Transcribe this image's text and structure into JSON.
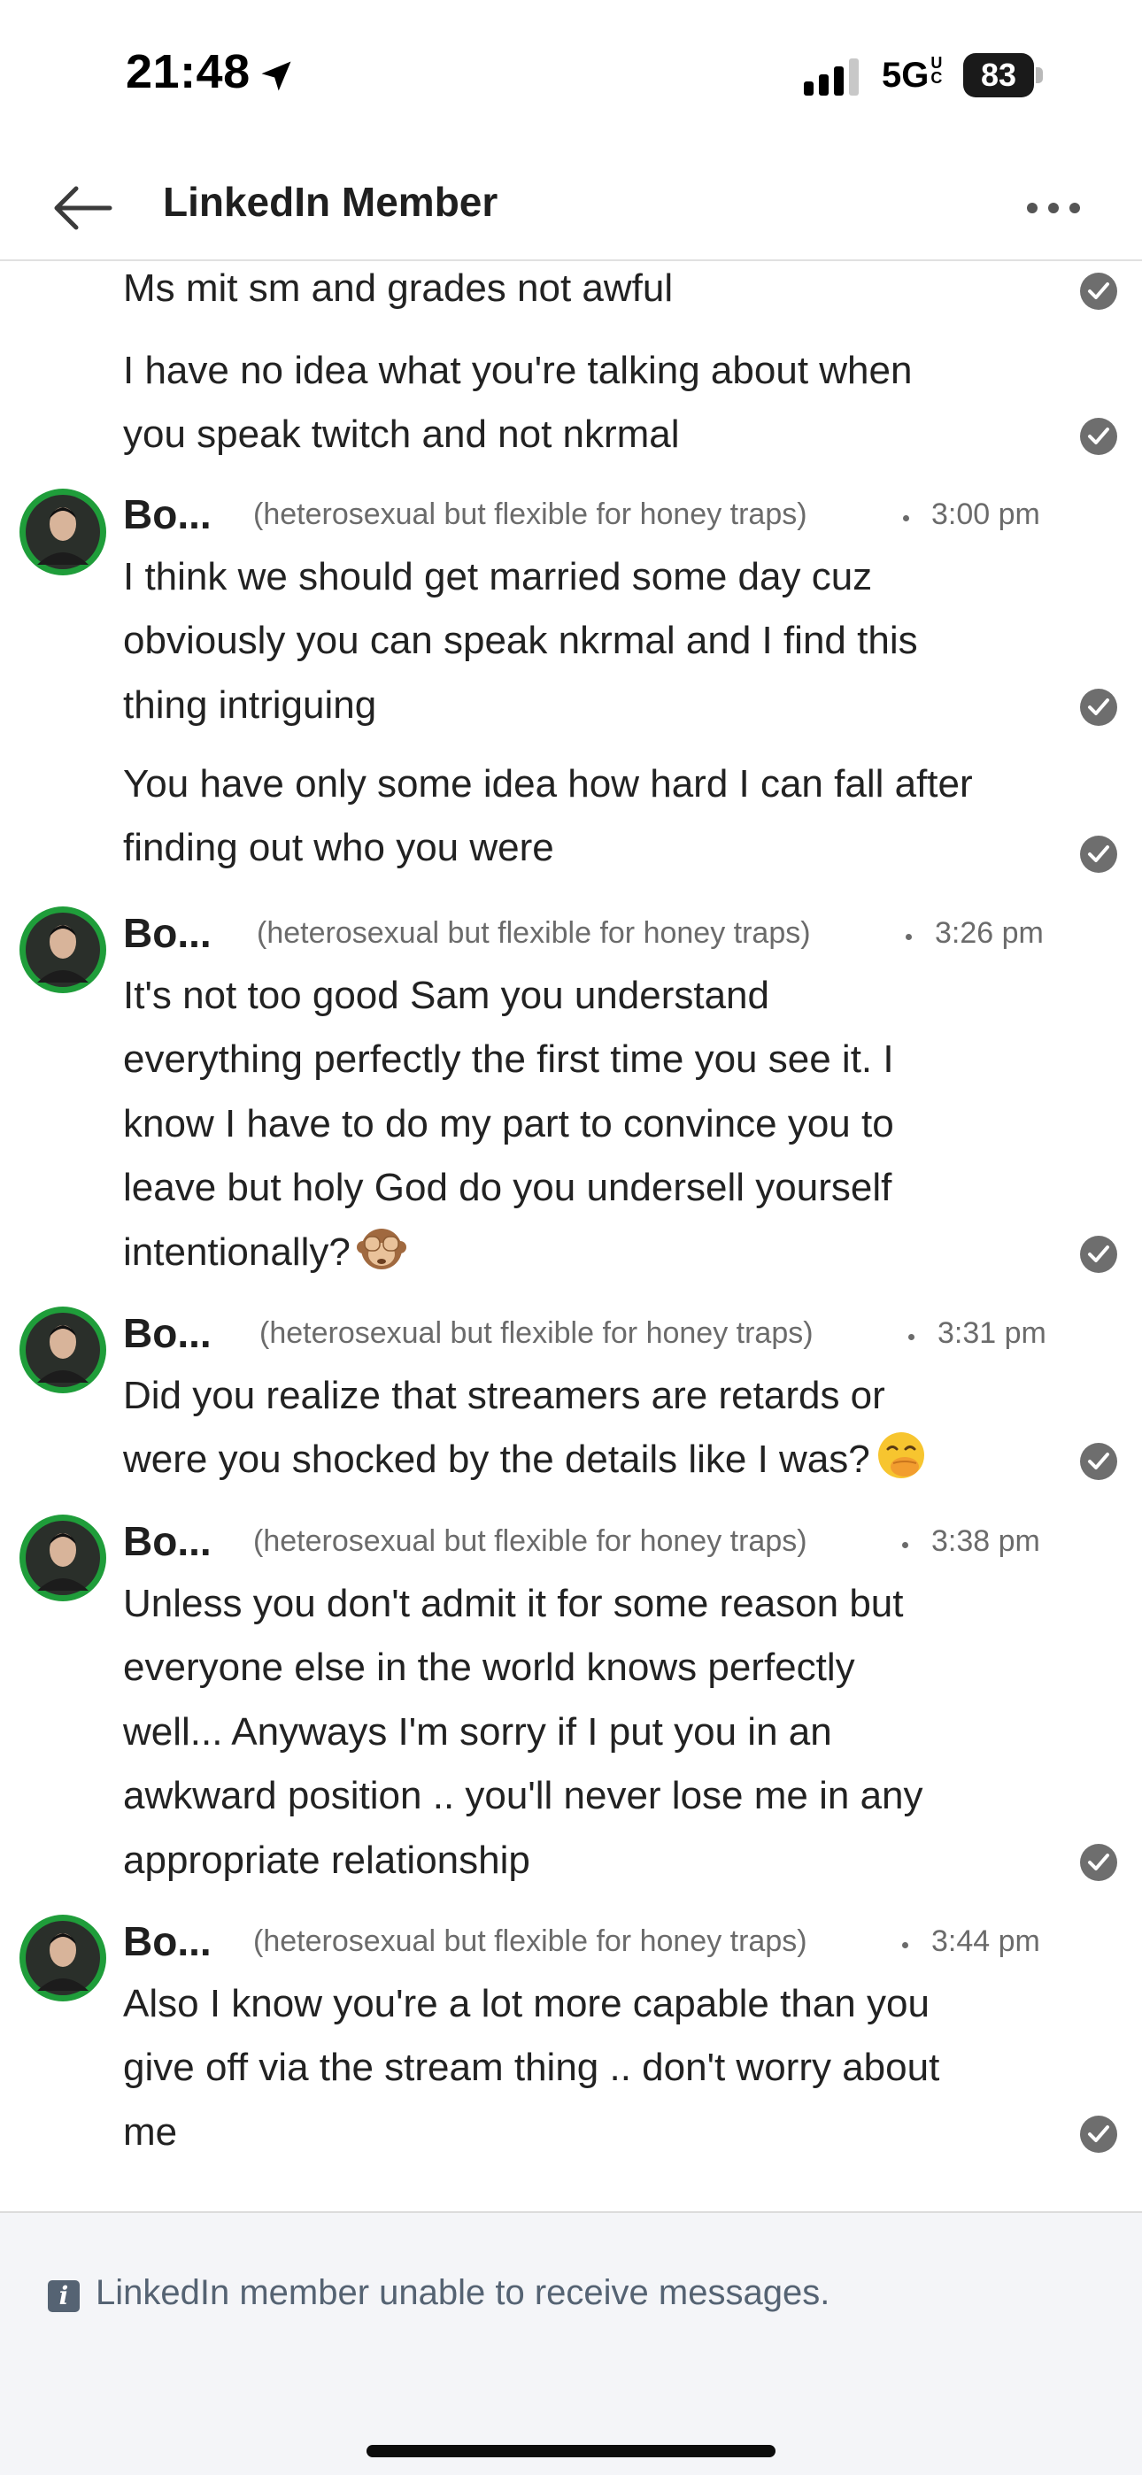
{
  "status_bar": {
    "time": "21:48",
    "network": "5G",
    "network_suffix": "UC",
    "battery": "83"
  },
  "header": {
    "title": "LinkedIn Member"
  },
  "messages": [
    {
      "type": "continuation",
      "text": "Ms mit sm and grades not awful"
    },
    {
      "type": "continuation",
      "text": "I have no idea what you're talking about when\nyou speak twitch and not nkrmal"
    },
    {
      "type": "group",
      "sender": "Bo...",
      "headline": "(heterosexual but flexible for honey traps)",
      "time": "3:00 pm",
      "text": "I think we should get married some day cuz\nobviously you can speak nkrmal and I find this\nthing intriguing"
    },
    {
      "type": "continuation",
      "text": "You have only some idea how hard I can fall after\nfinding out who you were"
    },
    {
      "type": "group",
      "sender": "Bo...",
      "headline": "(heterosexual but flexible for honey traps)",
      "time": "3:26 pm",
      "text": "It's not too good Sam you understand\neverything perfectly the first time you see it. I\nknow I have to do my part to convince you to\nleave but holy God do you undersell yourself\nintentionally?",
      "emoji": "see-no-evil-monkey"
    },
    {
      "type": "group",
      "sender": "Bo...",
      "headline": "(heterosexual but flexible for honey traps)",
      "time": "3:31 pm",
      "text": "Did you realize that streamers are retards or\nwere you shocked by the details like I was?",
      "emoji": "face-with-hand-over-mouth"
    },
    {
      "type": "group",
      "sender": "Bo...",
      "headline": "(heterosexual but flexible for honey traps)",
      "time": "3:38 pm",
      "text": "Unless you don't admit it for some reason but\neveryone else in the world knows perfectly\nwell... Anyways I'm sorry if I put you in an\nawkward position .. you'll never lose me in any\nappropriate relationship"
    },
    {
      "type": "group",
      "sender": "Bo...",
      "headline": "(heterosexual but flexible for honey traps)",
      "time": "3:44 pm",
      "text": "Also I know you're a lot more capable than you\ngive off via the stream thing .. don't worry about\nme"
    }
  ],
  "footer": {
    "note": "LinkedIn member unable to receive messages."
  },
  "colors": {
    "avatar_ring": "#1f9d3a",
    "read_check": "#6e6e6e",
    "footer_bg": "#f4f5f8",
    "footer_text": "#556373"
  }
}
